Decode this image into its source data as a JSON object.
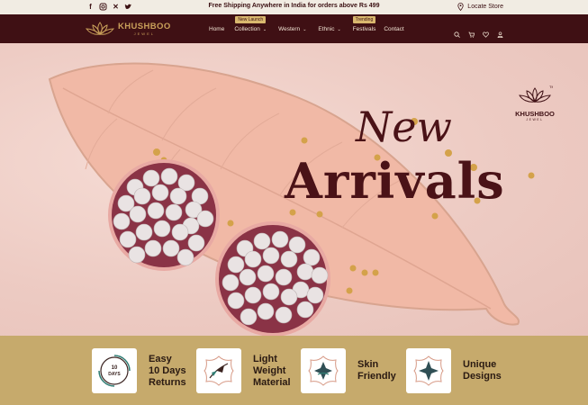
{
  "topbar": {
    "social_icons": [
      "facebook-icon",
      "instagram-icon",
      "x-icon",
      "twitter-icon"
    ],
    "shipping_text": "Free Shipping Anywhere in India for orders above Rs 499",
    "locate_store": "Locate Store"
  },
  "header": {
    "logo_name": "KHUSHBOO",
    "logo_sub": "JEWEL",
    "nav": [
      {
        "label": "Home",
        "has_dropdown": false,
        "tag": ""
      },
      {
        "label": "Collection",
        "has_dropdown": true,
        "tag": "New Launch"
      },
      {
        "label": "Western",
        "has_dropdown": true,
        "tag": ""
      },
      {
        "label": "Ethnic",
        "has_dropdown": true,
        "tag": ""
      },
      {
        "label": "Festivals",
        "has_dropdown": false,
        "tag": "Trending"
      },
      {
        "label": "Contact",
        "has_dropdown": false,
        "tag": ""
      }
    ],
    "icons": [
      "search-icon",
      "cart-icon",
      "wishlist-icon",
      "account-icon"
    ]
  },
  "hero": {
    "title_script": "New",
    "title_bold": "Arrivals",
    "brand_name": "KHUSHBOO",
    "brand_sub": "JEWEL",
    "brand_tm": "TM"
  },
  "features": [
    {
      "icon": "returns-icon",
      "icon_text": "10 DAYS",
      "line1": "Easy",
      "line2": "10 Days",
      "line3": "Returns"
    },
    {
      "icon": "feather-icon",
      "icon_text": "",
      "line1": "Light",
      "line2": "Weight",
      "line3": "Material"
    },
    {
      "icon": "skin-friendly-icon",
      "icon_text": "",
      "line1": "Skin",
      "line2": "Friendly",
      "line3": ""
    },
    {
      "icon": "unique-design-icon",
      "icon_text": "",
      "line1": "Unique",
      "line2": "Designs",
      "line3": ""
    }
  ],
  "colors": {
    "header_bg": "#3f1014",
    "gold": "#c9a05a",
    "feature_bg": "#c6aa6c",
    "title": "#4a1217",
    "topbar_bg": "#f1ece3"
  }
}
